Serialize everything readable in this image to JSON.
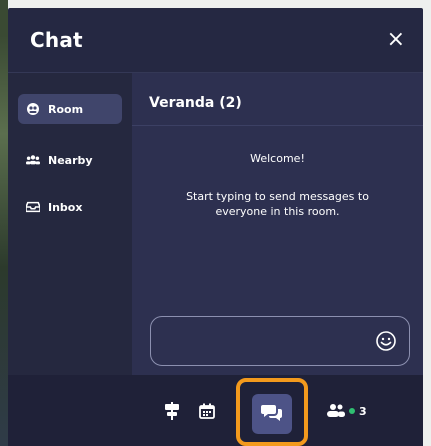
{
  "panel": {
    "title": "Chat",
    "close_label": "×"
  },
  "sidebar": {
    "items": [
      {
        "label": "Room",
        "icon": "room-icon",
        "active": true
      },
      {
        "label": "Nearby",
        "icon": "people-group-icon",
        "active": false
      },
      {
        "label": "Inbox",
        "icon": "inbox-icon",
        "active": false
      }
    ]
  },
  "room": {
    "title": "Veranda (2)",
    "welcome": "Welcome!",
    "hint": "Start typing to send messages to everyone in this room."
  },
  "input": {
    "value": "",
    "placeholder": "",
    "emoji_icon": "smiley-icon"
  },
  "bottom_bar": {
    "icons": [
      "sign-icon",
      "calendar-icon",
      "chat-bubbles-icon",
      "users-icon"
    ],
    "users_count": "3",
    "online_color": "#2fbf71",
    "highlight_color": "#f39a1d"
  }
}
